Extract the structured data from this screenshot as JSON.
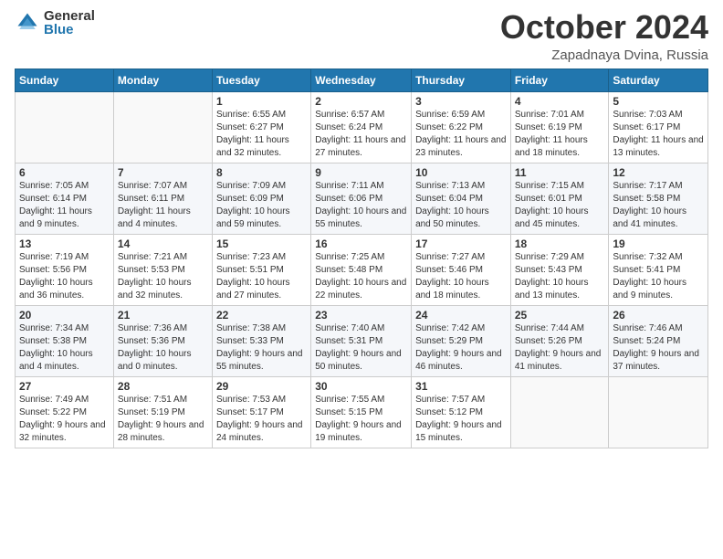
{
  "logo": {
    "general": "General",
    "blue": "Blue"
  },
  "header": {
    "month": "October 2024",
    "location": "Zapadnaya Dvina, Russia"
  },
  "weekdays": [
    "Sunday",
    "Monday",
    "Tuesday",
    "Wednesday",
    "Thursday",
    "Friday",
    "Saturday"
  ],
  "weeks": [
    [
      {
        "day": "",
        "sunrise": "",
        "sunset": "",
        "daylight": ""
      },
      {
        "day": "",
        "sunrise": "",
        "sunset": "",
        "daylight": ""
      },
      {
        "day": "1",
        "sunrise": "Sunrise: 6:55 AM",
        "sunset": "Sunset: 6:27 PM",
        "daylight": "Daylight: 11 hours and 32 minutes."
      },
      {
        "day": "2",
        "sunrise": "Sunrise: 6:57 AM",
        "sunset": "Sunset: 6:24 PM",
        "daylight": "Daylight: 11 hours and 27 minutes."
      },
      {
        "day": "3",
        "sunrise": "Sunrise: 6:59 AM",
        "sunset": "Sunset: 6:22 PM",
        "daylight": "Daylight: 11 hours and 23 minutes."
      },
      {
        "day": "4",
        "sunrise": "Sunrise: 7:01 AM",
        "sunset": "Sunset: 6:19 PM",
        "daylight": "Daylight: 11 hours and 18 minutes."
      },
      {
        "day": "5",
        "sunrise": "Sunrise: 7:03 AM",
        "sunset": "Sunset: 6:17 PM",
        "daylight": "Daylight: 11 hours and 13 minutes."
      }
    ],
    [
      {
        "day": "6",
        "sunrise": "Sunrise: 7:05 AM",
        "sunset": "Sunset: 6:14 PM",
        "daylight": "Daylight: 11 hours and 9 minutes."
      },
      {
        "day": "7",
        "sunrise": "Sunrise: 7:07 AM",
        "sunset": "Sunset: 6:11 PM",
        "daylight": "Daylight: 11 hours and 4 minutes."
      },
      {
        "day": "8",
        "sunrise": "Sunrise: 7:09 AM",
        "sunset": "Sunset: 6:09 PM",
        "daylight": "Daylight: 10 hours and 59 minutes."
      },
      {
        "day": "9",
        "sunrise": "Sunrise: 7:11 AM",
        "sunset": "Sunset: 6:06 PM",
        "daylight": "Daylight: 10 hours and 55 minutes."
      },
      {
        "day": "10",
        "sunrise": "Sunrise: 7:13 AM",
        "sunset": "Sunset: 6:04 PM",
        "daylight": "Daylight: 10 hours and 50 minutes."
      },
      {
        "day": "11",
        "sunrise": "Sunrise: 7:15 AM",
        "sunset": "Sunset: 6:01 PM",
        "daylight": "Daylight: 10 hours and 45 minutes."
      },
      {
        "day": "12",
        "sunrise": "Sunrise: 7:17 AM",
        "sunset": "Sunset: 5:58 PM",
        "daylight": "Daylight: 10 hours and 41 minutes."
      }
    ],
    [
      {
        "day": "13",
        "sunrise": "Sunrise: 7:19 AM",
        "sunset": "Sunset: 5:56 PM",
        "daylight": "Daylight: 10 hours and 36 minutes."
      },
      {
        "day": "14",
        "sunrise": "Sunrise: 7:21 AM",
        "sunset": "Sunset: 5:53 PM",
        "daylight": "Daylight: 10 hours and 32 minutes."
      },
      {
        "day": "15",
        "sunrise": "Sunrise: 7:23 AM",
        "sunset": "Sunset: 5:51 PM",
        "daylight": "Daylight: 10 hours and 27 minutes."
      },
      {
        "day": "16",
        "sunrise": "Sunrise: 7:25 AM",
        "sunset": "Sunset: 5:48 PM",
        "daylight": "Daylight: 10 hours and 22 minutes."
      },
      {
        "day": "17",
        "sunrise": "Sunrise: 7:27 AM",
        "sunset": "Sunset: 5:46 PM",
        "daylight": "Daylight: 10 hours and 18 minutes."
      },
      {
        "day": "18",
        "sunrise": "Sunrise: 7:29 AM",
        "sunset": "Sunset: 5:43 PM",
        "daylight": "Daylight: 10 hours and 13 minutes."
      },
      {
        "day": "19",
        "sunrise": "Sunrise: 7:32 AM",
        "sunset": "Sunset: 5:41 PM",
        "daylight": "Daylight: 10 hours and 9 minutes."
      }
    ],
    [
      {
        "day": "20",
        "sunrise": "Sunrise: 7:34 AM",
        "sunset": "Sunset: 5:38 PM",
        "daylight": "Daylight: 10 hours and 4 minutes."
      },
      {
        "day": "21",
        "sunrise": "Sunrise: 7:36 AM",
        "sunset": "Sunset: 5:36 PM",
        "daylight": "Daylight: 10 hours and 0 minutes."
      },
      {
        "day": "22",
        "sunrise": "Sunrise: 7:38 AM",
        "sunset": "Sunset: 5:33 PM",
        "daylight": "Daylight: 9 hours and 55 minutes."
      },
      {
        "day": "23",
        "sunrise": "Sunrise: 7:40 AM",
        "sunset": "Sunset: 5:31 PM",
        "daylight": "Daylight: 9 hours and 50 minutes."
      },
      {
        "day": "24",
        "sunrise": "Sunrise: 7:42 AM",
        "sunset": "Sunset: 5:29 PM",
        "daylight": "Daylight: 9 hours and 46 minutes."
      },
      {
        "day": "25",
        "sunrise": "Sunrise: 7:44 AM",
        "sunset": "Sunset: 5:26 PM",
        "daylight": "Daylight: 9 hours and 41 minutes."
      },
      {
        "day": "26",
        "sunrise": "Sunrise: 7:46 AM",
        "sunset": "Sunset: 5:24 PM",
        "daylight": "Daylight: 9 hours and 37 minutes."
      }
    ],
    [
      {
        "day": "27",
        "sunrise": "Sunrise: 7:49 AM",
        "sunset": "Sunset: 5:22 PM",
        "daylight": "Daylight: 9 hours and 32 minutes."
      },
      {
        "day": "28",
        "sunrise": "Sunrise: 7:51 AM",
        "sunset": "Sunset: 5:19 PM",
        "daylight": "Daylight: 9 hours and 28 minutes."
      },
      {
        "day": "29",
        "sunrise": "Sunrise: 7:53 AM",
        "sunset": "Sunset: 5:17 PM",
        "daylight": "Daylight: 9 hours and 24 minutes."
      },
      {
        "day": "30",
        "sunrise": "Sunrise: 7:55 AM",
        "sunset": "Sunset: 5:15 PM",
        "daylight": "Daylight: 9 hours and 19 minutes."
      },
      {
        "day": "31",
        "sunrise": "Sunrise: 7:57 AM",
        "sunset": "Sunset: 5:12 PM",
        "daylight": "Daylight: 9 hours and 15 minutes."
      },
      {
        "day": "",
        "sunrise": "",
        "sunset": "",
        "daylight": ""
      },
      {
        "day": "",
        "sunrise": "",
        "sunset": "",
        "daylight": ""
      }
    ]
  ]
}
